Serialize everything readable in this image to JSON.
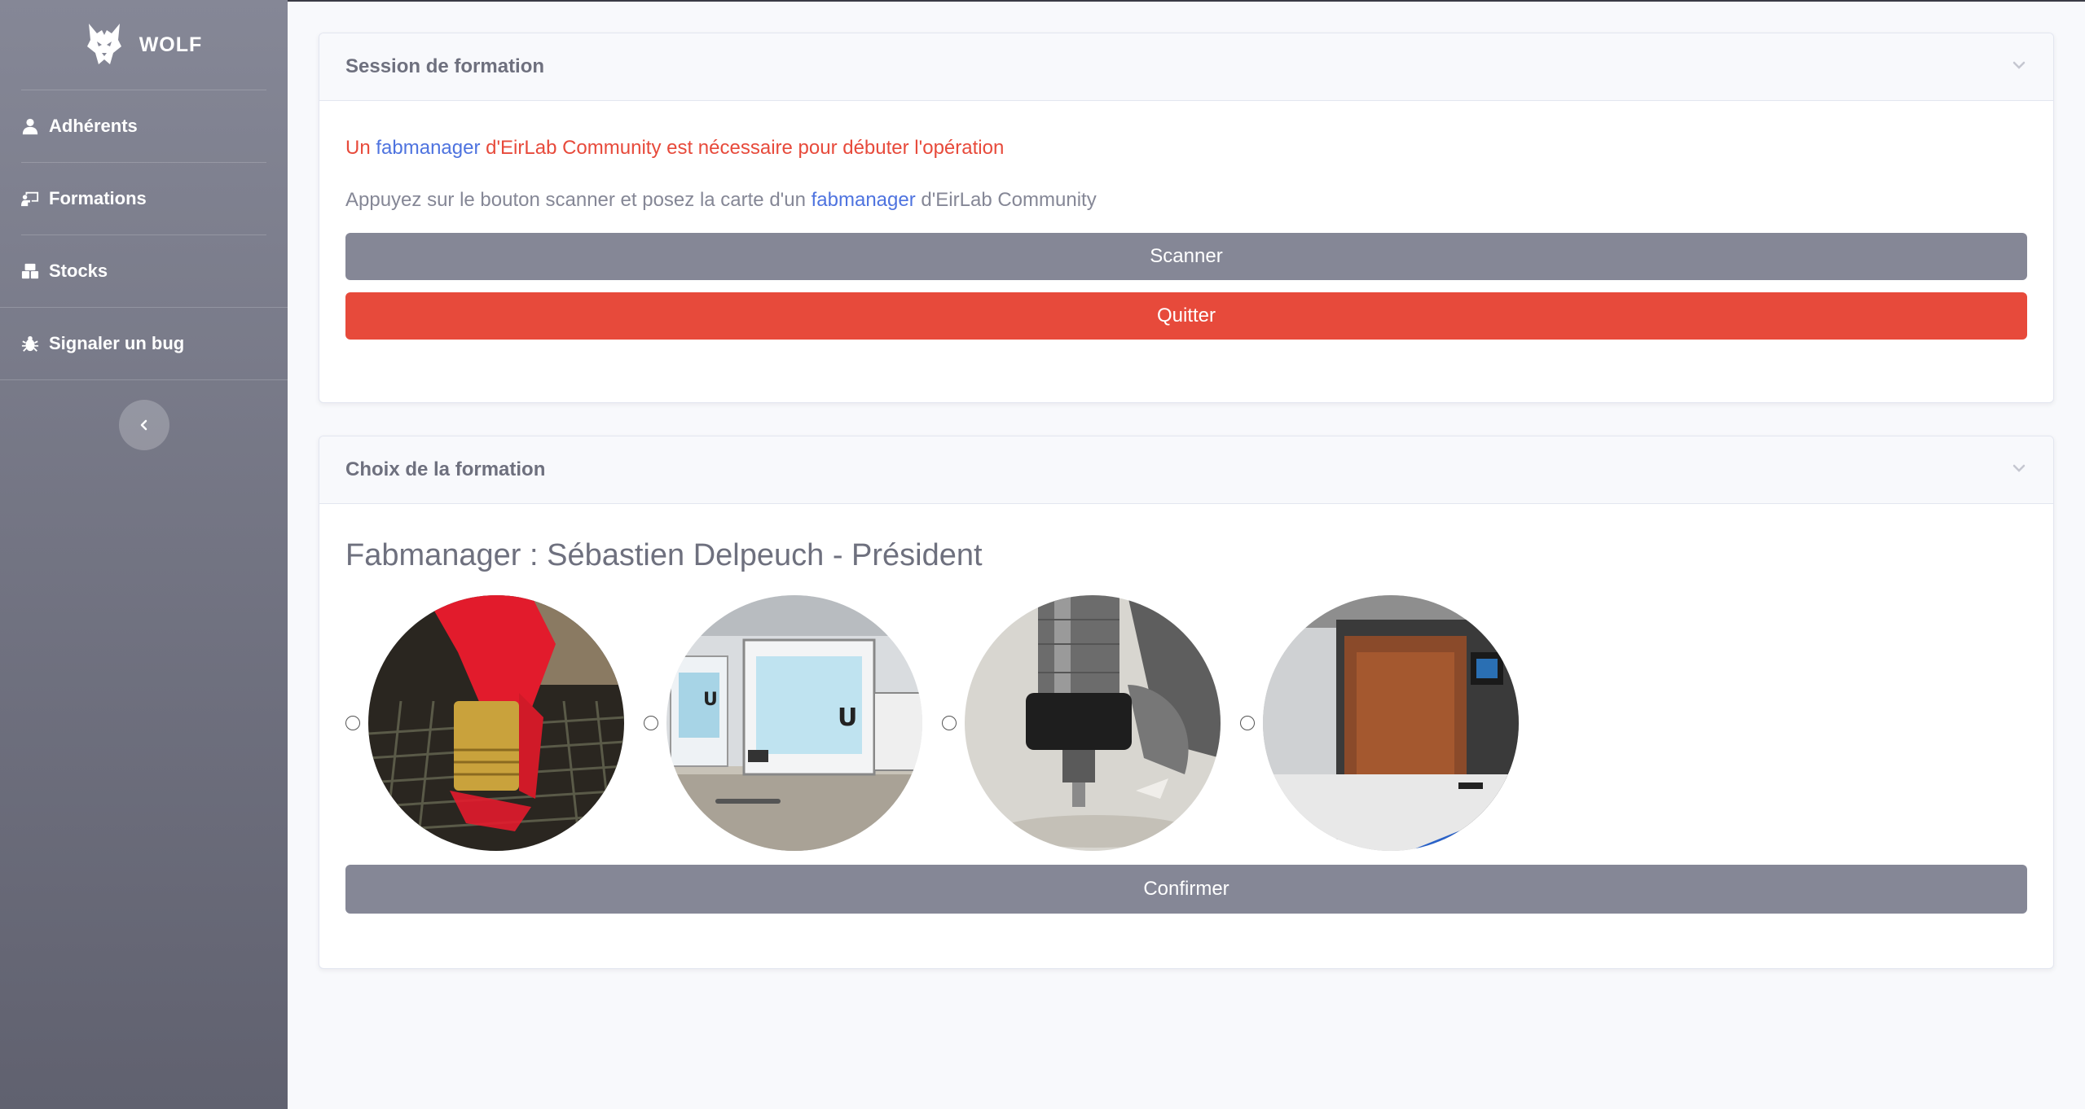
{
  "sidebar": {
    "brand": "WOLF",
    "items": [
      {
        "label": "Adhérents",
        "icon": "user-icon"
      },
      {
        "label": "Formations",
        "icon": "chalkboard-teacher-icon"
      },
      {
        "label": "Stocks",
        "icon": "boxes-icon"
      },
      {
        "label": "Signaler un bug",
        "icon": "bug-icon"
      }
    ],
    "toggle_icon": "chevron-left-icon"
  },
  "session": {
    "title": "Session de formation",
    "error_prefix": "Un ",
    "error_link": "fabmanager",
    "error_suffix": " d'EirLab Community est nécessaire pour débuter l'opération",
    "info_prefix": "Appuyez sur le bouton scanner et posez la carte d'un ",
    "info_link": "fabmanager",
    "info_suffix": " d'EirLab Community",
    "scan_label": "Scanner",
    "quit_label": "Quitter"
  },
  "choice": {
    "title": "Choix de la formation",
    "fabmanager_line": "Fabmanager : Sébastien Delpeuch - Président",
    "options": [
      {
        "image": "laser-cutter-photo"
      },
      {
        "image": "3d-printer-photo"
      },
      {
        "image": "milling-machine-photo"
      },
      {
        "image": "resin-printer-photo"
      }
    ],
    "confirm_label": "Confirmer"
  },
  "colors": {
    "sidebar_top": "#858796",
    "sidebar_bottom": "#60616f",
    "primary_link": "#4e73df",
    "danger": "#e74a3b",
    "secondary": "#858796"
  }
}
